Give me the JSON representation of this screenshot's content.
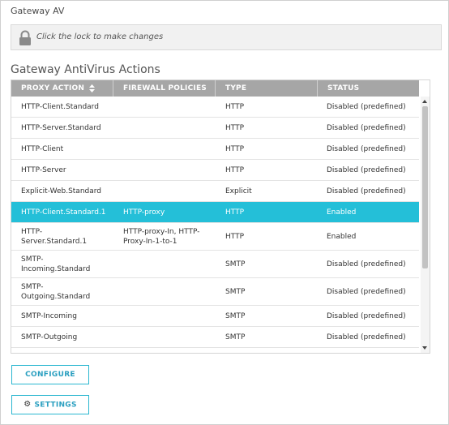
{
  "page": {
    "title": "Gateway AV"
  },
  "lockbar": {
    "message": "Click the lock to make changes",
    "icon": "lock-icon"
  },
  "section": {
    "title": "Gateway AntiVirus Actions"
  },
  "table": {
    "columns": [
      {
        "label": "PROXY ACTION",
        "sortable": true
      },
      {
        "label": "FIREWALL POLICIES"
      },
      {
        "label": "TYPE"
      },
      {
        "label": "STATUS"
      }
    ],
    "rows": [
      {
        "proxy": "HTTP-Client.Standard",
        "policies": "",
        "type": "HTTP",
        "status": "Disabled (predefined)"
      },
      {
        "proxy": "HTTP-Server.Standard",
        "policies": "",
        "type": "HTTP",
        "status": "Disabled (predefined)"
      },
      {
        "proxy": "HTTP-Client",
        "policies": "",
        "type": "HTTP",
        "status": "Disabled (predefined)"
      },
      {
        "proxy": "HTTP-Server",
        "policies": "",
        "type": "HTTP",
        "status": "Disabled (predefined)"
      },
      {
        "proxy": "Explicit-Web.Standard",
        "policies": "",
        "type": "Explicit",
        "status": "Disabled (predefined)"
      },
      {
        "proxy": "HTTP-Client.Standard.1",
        "policies": "HTTP-proxy",
        "type": "HTTP",
        "status": "Enabled",
        "selected": true
      },
      {
        "proxy": "HTTP-\nServer.Standard.1",
        "policies": "HTTP-proxy-In, HTTP-\nProxy-In-1-to-1",
        "type": "HTTP",
        "status": "Enabled"
      },
      {
        "proxy": "SMTP-\nIncoming.Standard",
        "policies": "",
        "type": "SMTP",
        "status": "Disabled (predefined)"
      },
      {
        "proxy": "SMTP-\nOutgoing.Standard",
        "policies": "",
        "type": "SMTP",
        "status": "Disabled (predefined)"
      },
      {
        "proxy": "SMTP-Incoming",
        "policies": "",
        "type": "SMTP",
        "status": "Disabled (predefined)"
      },
      {
        "proxy": "SMTP-Outgoing",
        "policies": "",
        "type": "SMTP",
        "status": "Disabled (predefined)"
      }
    ]
  },
  "buttons": {
    "configure": "CONFIGURE",
    "settings": "SETTINGS",
    "settings_icon": "gear-icon"
  },
  "colors": {
    "selected_row": "#24bfd8",
    "header_bg": "#a6a6a6",
    "button_border": "#2bb7d0",
    "button_text": "#2a9fc0"
  }
}
